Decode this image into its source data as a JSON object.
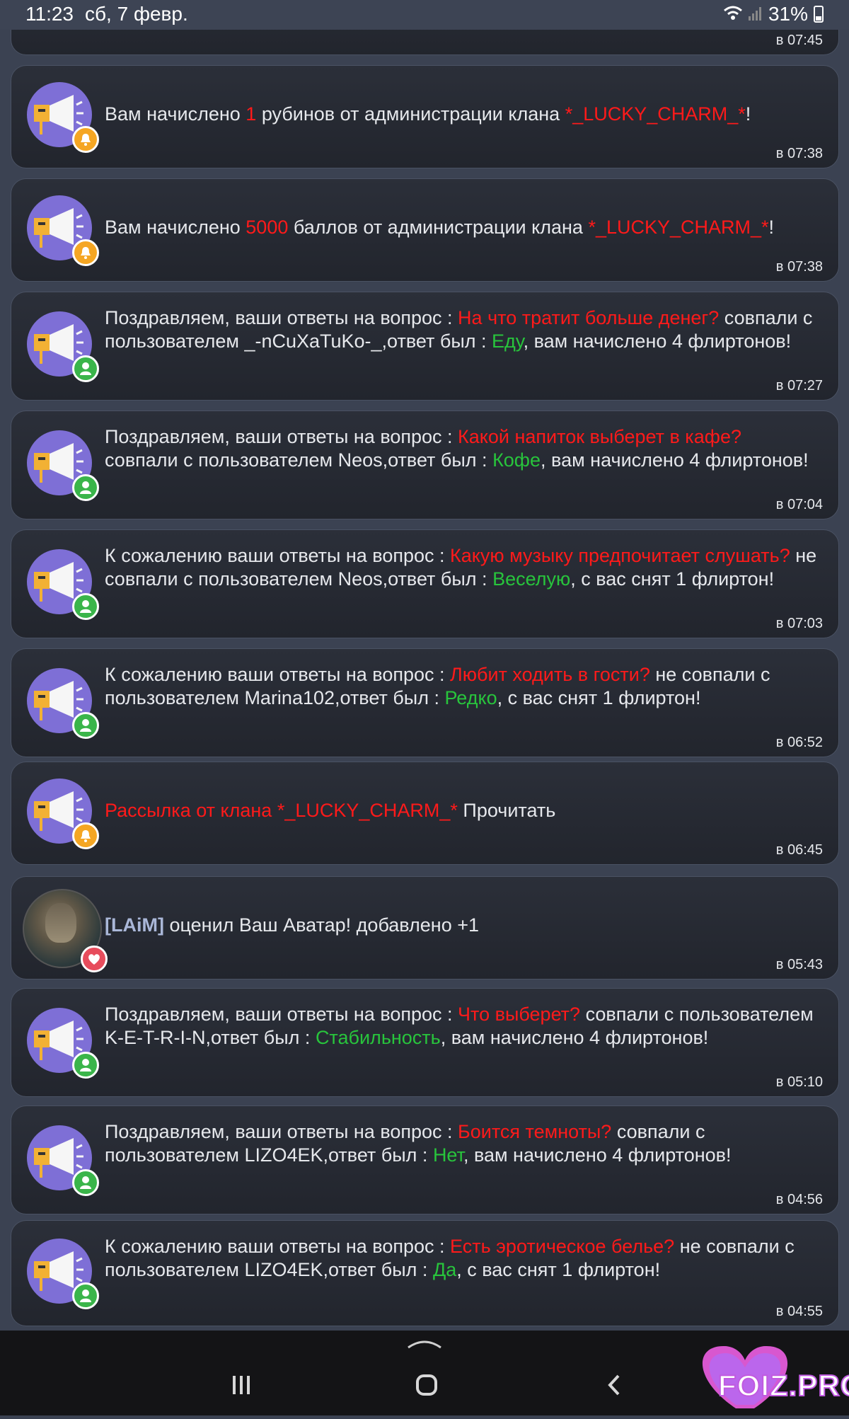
{
  "status": {
    "time": "11:23",
    "date": "сб, 7 февр.",
    "battery": "31%"
  },
  "top_partial_time": "в 07:45",
  "cards": [
    {
      "segments": [
        {
          "text": "Вам начислено "
        },
        {
          "text": "1",
          "color": "red"
        },
        {
          "text": " рубинов от администрации клана "
        },
        {
          "text": "*_LUCKY_CHARM_*",
          "color": "red"
        },
        {
          "text": "!"
        }
      ],
      "time": "в 07:38",
      "badge": "bell"
    },
    {
      "segments": [
        {
          "text": "Вам начислено "
        },
        {
          "text": "5000",
          "color": "red"
        },
        {
          "text": " баллов от администрации клана "
        },
        {
          "text": "*_LUCKY_CHARM_*",
          "color": "red"
        },
        {
          "text": "!"
        }
      ],
      "time": "в 07:38",
      "badge": "bell"
    },
    {
      "segments": [
        {
          "text": "Поздравляем, ваши ответы на вопрос : "
        },
        {
          "text": "На что тратит больше денег?",
          "color": "red"
        },
        {
          "text": " совпали с пользователем _-nCuXaTuKo-_,ответ был : "
        },
        {
          "text": "Еду",
          "color": "green"
        },
        {
          "text": ", вам начислено 4 флиртонов!"
        }
      ],
      "time": "в 07:27",
      "badge": "user"
    },
    {
      "segments": [
        {
          "text": "Поздравляем, ваши ответы на вопрос : "
        },
        {
          "text": "Какой напиток выберет в кафе?",
          "color": "red"
        },
        {
          "text": " совпали с пользователем Neos,ответ был : "
        },
        {
          "text": "Кофе",
          "color": "green"
        },
        {
          "text": ", вам начислено 4 флиртонов!"
        }
      ],
      "time": "в 07:04",
      "badge": "user"
    },
    {
      "segments": [
        {
          "text": "К сожалению ваши ответы на вопрос : "
        },
        {
          "text": "Какую музыку предпочитает слушать?",
          "color": "red"
        },
        {
          "text": " не совпали с пользователем Neos,ответ был : "
        },
        {
          "text": "Веселую",
          "color": "green"
        },
        {
          "text": ", с вас снят 1 флиртон!"
        }
      ],
      "time": "в 07:03",
      "badge": "user"
    },
    {
      "segments": [
        {
          "text": "К сожалению ваши ответы на вопрос : "
        },
        {
          "text": "Любит ходить в гости?",
          "color": "red"
        },
        {
          "text": " не совпали с пользователем Marina102,ответ был : "
        },
        {
          "text": "Редко",
          "color": "green"
        },
        {
          "text": ", с вас снят 1 флиртон!"
        }
      ],
      "time": "в 06:52",
      "badge": "user"
    },
    {
      "segments": [
        {
          "text": "Рассылка от клана *_LUCKY_CHARM_*",
          "color": "red"
        },
        {
          "text": " Прочитать"
        }
      ],
      "time": "в 06:45",
      "badge": "bell"
    },
    {
      "segments": [
        {
          "text": "[LAiM]",
          "color": "nick"
        },
        {
          "text": " оценил Ваш Аватар! добавлено +1"
        }
      ],
      "time": "в 05:43",
      "badge": "heart",
      "photo": true
    },
    {
      "segments": [
        {
          "text": "Поздравляем, ваши ответы на вопрос : "
        },
        {
          "text": "Что выберет?",
          "color": "red"
        },
        {
          "text": " совпали с пользователем K-E-T-R-I-N,ответ был : "
        },
        {
          "text": "Стабильность",
          "color": "green"
        },
        {
          "text": ", вам начислено 4 флиртонов!"
        }
      ],
      "time": "в 05:10",
      "badge": "user"
    },
    {
      "segments": [
        {
          "text": "Поздравляем, ваши ответы на вопрос : "
        },
        {
          "text": "Боится темноты?",
          "color": "red"
        },
        {
          "text": " совпали с пользователем LIZO4EK,ответ был : "
        },
        {
          "text": "Нет",
          "color": "green"
        },
        {
          "text": ", вам начислено 4 флиртонов!"
        }
      ],
      "time": "в 04:56",
      "badge": "user"
    },
    {
      "segments": [
        {
          "text": "К сожалению ваши ответы на вопрос : "
        },
        {
          "text": "Есть эротическое белье?",
          "color": "red"
        },
        {
          "text": " не совпали с пользователем LIZO4EK,ответ был : "
        },
        {
          "text": "Да",
          "color": "green"
        },
        {
          "text": ", с вас снят 1 флиртон!"
        }
      ],
      "time": "в 04:55",
      "badge": "user"
    }
  ],
  "watermark": "FOIZ.PRO",
  "colors": {
    "red": "#ff1a1a",
    "green": "#28c43c",
    "avatar": "#7e6fd6",
    "bell_badge": "#f5a623",
    "user_badge": "#3ab54a",
    "heart_badge": "#e74c5c"
  },
  "icons": {
    "bell": "bell-icon",
    "user": "user-icon",
    "heart": "heart-icon",
    "avatar": "megaphone-icon"
  }
}
